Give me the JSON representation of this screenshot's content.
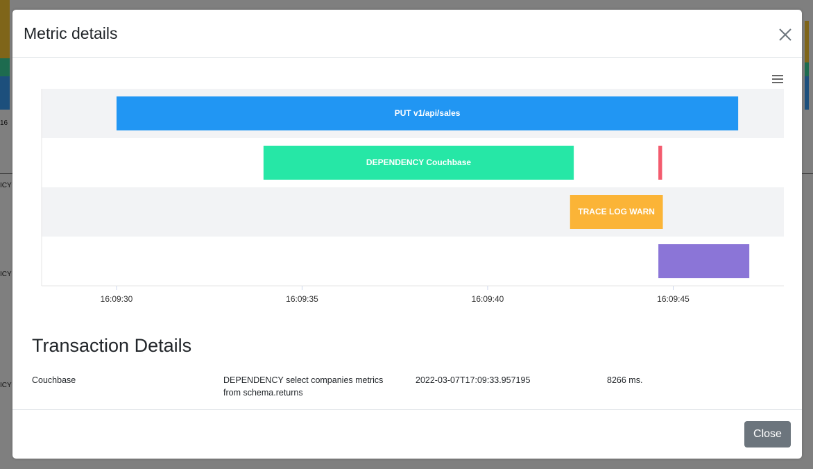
{
  "background": {
    "side_texts": [
      "16",
      "ICY",
      "ICY",
      "ICY"
    ]
  },
  "modal": {
    "title": "Metric details",
    "close_icon": "close-icon",
    "menu_icon": "hamburger-menu-icon",
    "footer": {
      "close_label": "Close"
    }
  },
  "chart_data": {
    "type": "timeline",
    "x_tick_labels": [
      "16:09:30",
      "16:09:35",
      "16:09:40",
      "16:09:45"
    ],
    "x_ticks": [
      30,
      35,
      40,
      45
    ],
    "x_range": [
      28,
      48
    ],
    "rows": 4,
    "bars": [
      {
        "row": 0,
        "start": 30.0,
        "end": 46.75,
        "label": "PUT v1/api/sales",
        "color": "#2196f3"
      },
      {
        "row": 1,
        "start": 33.96,
        "end": 42.32,
        "label": "DEPENDENCY Couchbase",
        "color": "#26e7a6"
      },
      {
        "row": 1,
        "start": 44.6,
        "end": 44.7,
        "label": "",
        "color": "#f35b6e"
      },
      {
        "row": 2,
        "start": 42.22,
        "end": 44.72,
        "label": "TRACE LOG WARN",
        "color": "#fbb437"
      },
      {
        "row": 3,
        "start": 44.6,
        "end": 47.05,
        "label": "",
        "color": "#8b75d7"
      }
    ],
    "row_colors": [
      "#f2f3f5",
      "#ffffff",
      "#f2f3f5",
      "#ffffff"
    ]
  },
  "transaction": {
    "heading": "Transaction Details",
    "row": {
      "source": "Couchbase",
      "description": "DEPENDENCY select companies metrics from schema.returns",
      "timestamp": "2022-03-07T17:09:33.957195",
      "duration": "8266 ms."
    }
  }
}
